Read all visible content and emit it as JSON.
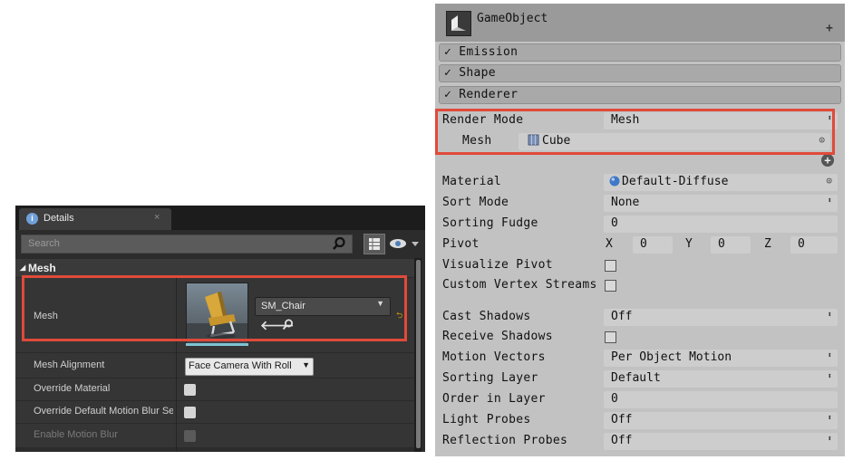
{
  "unreal_panel": {
    "tab_label": "Details",
    "tab_close": "×",
    "search_placeholder": "Search",
    "category": "Mesh",
    "mesh_label": "Mesh",
    "mesh_asset": "SM_Chair",
    "rows": [
      {
        "label": "Mesh Alignment",
        "value": "Face Camera With Roll"
      },
      {
        "label": "Override Material",
        "checked": false
      },
      {
        "label": "Override Default Motion Blur Settings",
        "checked": false
      },
      {
        "label": "Enable Motion Blur",
        "checked": false,
        "disabled": true
      }
    ],
    "accent_color": "#e04a3a"
  },
  "unity_inspector": {
    "title": "GameObject",
    "add_icon": "+",
    "modules": [
      {
        "label": "✓ Emission"
      },
      {
        "label": "✓ Shape"
      },
      {
        "label": "✓ Renderer"
      }
    ],
    "render_mode": {
      "label": "Render Mode",
      "value": "Mesh"
    },
    "mesh": {
      "label": "Mesh",
      "value": "Cube"
    },
    "material": {
      "label": "Material",
      "value": "Default-Diffuse"
    },
    "sort_mode": {
      "label": "Sort Mode",
      "value": "None"
    },
    "sorting_fudge": {
      "label": "Sorting Fudge",
      "value": "0"
    },
    "pivot": {
      "label": "Pivot",
      "x_label": "X",
      "x": "0",
      "y_label": "Y",
      "y": "0",
      "z_label": "Z",
      "z": "0"
    },
    "visualize_pivot": {
      "label": "Visualize Pivot",
      "checked": false
    },
    "custom_vertex_streams": {
      "label": "Custom Vertex Streams",
      "checked": false
    },
    "cast_shadows": {
      "label": "Cast Shadows",
      "value": "Off"
    },
    "receive_shadows": {
      "label": "Receive Shadows",
      "checked": false
    },
    "motion_vectors": {
      "label": "Motion Vectors",
      "value": "Per Object Motion"
    },
    "sorting_layer": {
      "label": "Sorting Layer",
      "value": "Default"
    },
    "order_in_layer": {
      "label": "Order in Layer",
      "value": "0"
    },
    "light_probes": {
      "label": "Light Probes",
      "value": "Off"
    },
    "reflection_probes": {
      "label": "Reflection Probes",
      "value": "Off"
    }
  }
}
